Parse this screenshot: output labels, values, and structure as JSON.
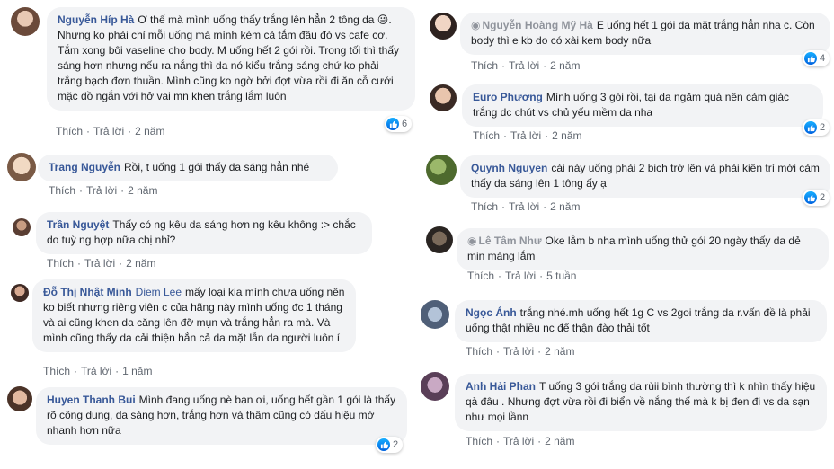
{
  "ui": {
    "like_label": "Thích",
    "reply_label": "Trả lời",
    "like_color": "#385898"
  },
  "comments": [
    {
      "id": "c1",
      "name": "Nguyễn Híp Hà",
      "text": "Ơ thế mà mình uống thấy trắng lên hẳn 2 tông da 😜. Nhưng ko phải chỉ mỗi uống mà mình kèm cả tắm đâu đó vs cafe cơ. Tắm xong bôi vaseline cho body. M uống hết 2 gói rồi. Trong tối thì thấy sáng hơn nhưng nếu ra nắng thì da nó kiểu trắng sáng chứ ko phải trắng bạch đơn thuần. Mình cũng ko ngờ bởi đợt vừa rồi đi ăn cỗ cưới mặc đồ ngắn với hở vai mn khen trắng lắm luôn",
      "time": "2 năm",
      "likes": "6"
    },
    {
      "id": "c2",
      "name": "Trang Nguyễn",
      "text": "Rồi, t uống 1 gói thấy da sáng hẳn nhé",
      "time": "2 năm",
      "likes": ""
    },
    {
      "id": "c3",
      "name": "Trần Nguyệt",
      "text": "Thấy có ng kêu da sáng hơn ng kêu không :> chắc do tuỳ ng hợp nữa chị nhỉ?",
      "time": "2 năm",
      "likes": ""
    },
    {
      "id": "c4",
      "name": "Đỗ Thị Nhật Minh",
      "tag": "Diem Lee",
      "text": "mấy loại kia mình chưa uống nên ko biết nhưng riêng viên c của hãng này mình uống đc 1 tháng và ai cũng khen da căng lên đỡ mụn và trắng hẳn ra mà. Và mình cũng thấy da cải thiện hẳn cả da mặt lẫn da người luôn í",
      "time": "1 năm",
      "likes": ""
    },
    {
      "id": "c5",
      "name": "Huyen Thanh Bui",
      "text": "Mình đang uống nè bạn ơi, uống hết gần 1 gói là thấy rõ công dụng, da sáng hơn, trắng hơn và thâm cũng có dấu hiệu mờ nhanh hơn nữa",
      "time": "",
      "likes": "2"
    },
    {
      "id": "c6",
      "name": "Nguyễn Hoàng Mỹ Hà",
      "text": "E uống hết 1 gói da mặt trắng hẳn nha c. Còn body thì e kb do có xài kem body nữa",
      "time": "2 năm",
      "likes": "4"
    },
    {
      "id": "c7",
      "name": "Euro Phương",
      "text": "Mình uống 3 gói rồi, tại da ngăm quá nên cảm giác trắng dc chút vs chủ yếu mềm da nha",
      "time": "2 năm",
      "likes": "2"
    },
    {
      "id": "c8",
      "name": "Quynh Nguyen",
      "text": "cái này uống phải 2 bịch trở lên và phải kiên trì mới cảm thấy da sáng lên 1 tông ấy ạ",
      "time": "2 năm",
      "likes": "2"
    },
    {
      "id": "c9",
      "name": "Lê Tâm Như",
      "text": "Oke lắm b nha mình uống thử gói 20 ngày thấy da dẻ mịn màng lắm",
      "time": "5 tuần",
      "likes": ""
    },
    {
      "id": "c10",
      "name": "Ngọc Ánh",
      "text": "trắng nhé.mh uống hết 1g C vs 2goi trắng da r.vấn đề là phải uống thật nhiều nc để thận đào thải tốt",
      "time": "2 năm",
      "likes": ""
    },
    {
      "id": "c11",
      "name": "Anh Hải Phan",
      "text": "T uống 3 gói trắng da rùii bình thường thì k nhìn thấy hiệu qả đâu . Nhưng đợt vừa rồi đi biển về nắng thế mà k bị đen đi vs da sạn như mọi lầnn",
      "time": "2 năm",
      "likes": ""
    }
  ]
}
